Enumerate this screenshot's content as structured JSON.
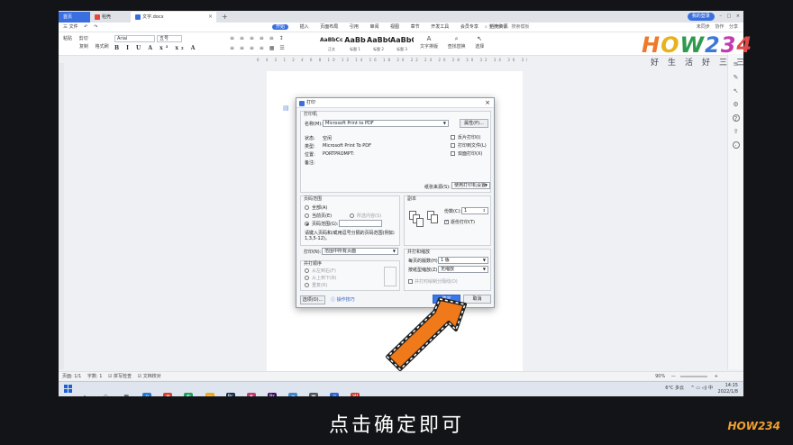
{
  "tabs": [
    {
      "label": "首页"
    },
    {
      "label": "稻壳"
    },
    {
      "label": "文字.docx"
    }
  ],
  "window": {
    "login": "我的登录",
    "icons": [
      "–",
      "□",
      "×"
    ]
  },
  "menubar": {
    "left": [
      "三 文件",
      "↶",
      "↷"
    ],
    "items": [
      "开始",
      "插入",
      "页面布局",
      "引用",
      "审阅",
      "视图",
      "章节",
      "开发工具",
      "会员专享",
      "稻壳资源"
    ],
    "search": "查找命令、搜索模板",
    "right": [
      "未同步",
      "协作",
      "分享"
    ]
  },
  "ribbon": {
    "clipboard": [
      "粘贴",
      "剪切",
      "复制",
      "格式刷"
    ],
    "font": "Arial",
    "size": "五号",
    "format": "B I U A x² x₂ A",
    "para1": "≡ ≡ ≡ ≡ ≡ ↕",
    "para2": "≡ ≡ ≡ ≡ ▦ ☰",
    "styles": [
      {
        "preview": "AaBbCcDd",
        "name": "正文"
      },
      {
        "preview": "AaBb",
        "name": "标题 1"
      },
      {
        "preview": "AaBbC",
        "name": "标题 2"
      },
      {
        "preview": "AaBbC",
        "name": "标题 3"
      }
    ],
    "tools": [
      {
        "icon": "A",
        "label": "文字排版"
      },
      {
        "icon": "⌕",
        "label": "查找替换"
      },
      {
        "icon": "↖",
        "label": "选择"
      }
    ]
  },
  "ruler": "6 4 2 1 2 4 6 8 10 12 14 16 18 20 22 24 26 28 30 32 34 36 38 40",
  "dialog": {
    "title": "打印",
    "printer_section": "打印机",
    "name_label": "名称(M):",
    "printer_name": "Microsoft Print to PDF",
    "properties": "属性(P)...",
    "status_label": "状态:",
    "status_value": "空闲",
    "type_label": "类型:",
    "type_value": "Microsoft Print To PDF",
    "where_label": "位置:",
    "where_value": "PORTPROMPT:",
    "comment_label": "备注:",
    "reverse": "反片打印(I)",
    "to_file": "打印到文件(L)",
    "duplex": "双面打印(X)",
    "paper_source_label": "纸张来源(S):",
    "paper_source": "使用打印机设置",
    "range_section": "页码范围",
    "all": "全部(A)",
    "current": "当前页(E)",
    "selection": "所选内容(S)",
    "pages": "页码范围(G):",
    "pages_value": "",
    "hint": "请键入页码和/或用逗号分隔的页码范围(例如: 1,3,5-12)。",
    "print_label": "打印(N):",
    "print_value": "范围中所有页面",
    "order_section": "并打顺序",
    "order1": "从左到右(F)",
    "order2": "从上到下(B)",
    "order3": "重复(R)",
    "copies_section": "副本",
    "copies_label": "份数(C):",
    "copies_value": "1",
    "collate": "逐份打印(T)",
    "zoom_section": "并打和缩放",
    "pps_label": "每页的版数(H):",
    "pps_value": "1 版",
    "scale_label": "按纸型缩放(Z):",
    "scale_value": "无缩放",
    "scale_check": "并打时绘制分隔线(D)",
    "options": "选项(O)...",
    "tips": "操作技巧",
    "ok": "确定",
    "cancel": "取消"
  },
  "status": {
    "left": [
      "页面: 1/1",
      "字数: 1",
      "☑ 拼写检查",
      "☑ 文档校对"
    ],
    "zoom": "90%",
    "right": [
      "—",
      "+"
    ]
  },
  "tray": {
    "weather": "6°C 多云",
    "icons": "^ ▭ ◁) 中",
    "time": "14:15",
    "date": "2022/1/8"
  },
  "caption": "点击确定即可",
  "brand": {
    "logo": "HOW234",
    "tagline": "好生活好三三",
    "corner": "HOW234"
  },
  "colors": {
    "accent": "#3b6fe0",
    "arrow": "#f07a1a"
  }
}
